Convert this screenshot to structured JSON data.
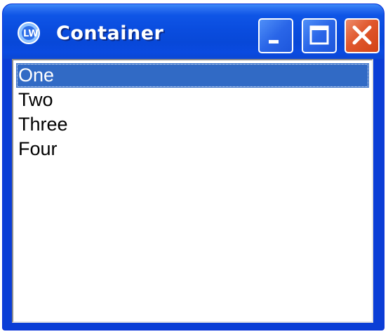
{
  "window": {
    "title": "Container",
    "icon": "lw-app-icon",
    "buttons": {
      "minimize": "minimize-icon",
      "maximize": "maximize-icon",
      "close": "close-icon"
    }
  },
  "list": {
    "items": [
      {
        "label": "One",
        "selected": true
      },
      {
        "label": "Two",
        "selected": false
      },
      {
        "label": "Three",
        "selected": false
      },
      {
        "label": "Four",
        "selected": false
      }
    ]
  },
  "colors": {
    "titlebar": "#0a4ddf",
    "selection": "#316ac5",
    "close_button": "#e0572c"
  }
}
